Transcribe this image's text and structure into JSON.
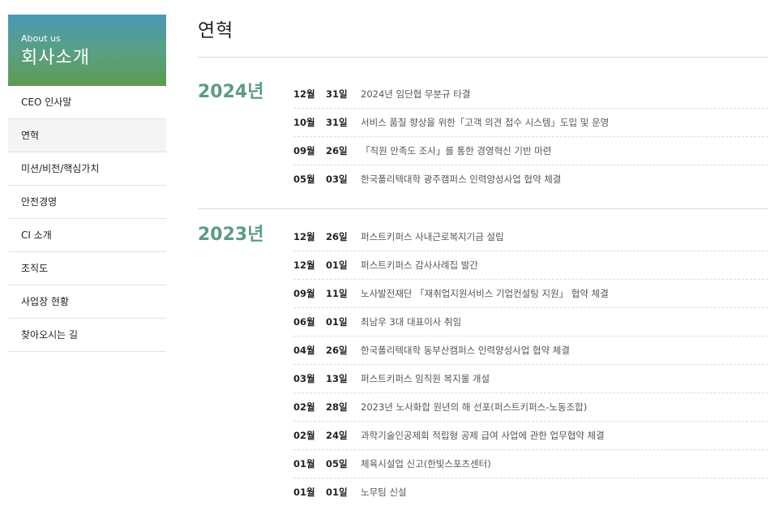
{
  "sidebar": {
    "subtitle": "About us",
    "title": "회사소개",
    "items": [
      {
        "label": "CEO 인사말"
      },
      {
        "label": "연혁"
      },
      {
        "label": "미션/비전/핵심가치"
      },
      {
        "label": "안전경영"
      },
      {
        "label": "CI 소개"
      },
      {
        "label": "조직도"
      },
      {
        "label": "사업장 현황"
      },
      {
        "label": "찾아오시는 길"
      }
    ],
    "active_item": "연혁"
  },
  "main": {
    "title": "연혁",
    "years": [
      {
        "year": "2024년",
        "events": [
          {
            "month": "12월",
            "day": "31일",
            "text": "2024년 임단협 무분규 타결"
          },
          {
            "month": "10월",
            "day": "31일",
            "text": "서비스 품질 향상을 위한「고객 의견 접수 시스템」도입 및 운영"
          },
          {
            "month": "09월",
            "day": "26일",
            "text": "「직원 만족도 조사」를 통한 경영혁신 기반 마련"
          },
          {
            "month": "05월",
            "day": "03일",
            "text": "한국폴리텍대학 광주캠퍼스 인력양성사업 협약 체결"
          }
        ]
      },
      {
        "year": "2023년",
        "events": [
          {
            "month": "12월",
            "day": "26일",
            "text": "퍼스트키퍼스 사내근로복지기금 설립"
          },
          {
            "month": "12월",
            "day": "01일",
            "text": "퍼스트키퍼스 감사사례집 발간"
          },
          {
            "month": "09월",
            "day": "11일",
            "text": "노사발전재단 「재취업지원서비스 기업컨설팅 지원」 협약 체결"
          },
          {
            "month": "06월",
            "day": "01일",
            "text": "최남우 3대 대표이사 취임"
          },
          {
            "month": "04월",
            "day": "26일",
            "text": "한국폴리텍대학 동부산캠퍼스 인력양성사업 협약 체결"
          },
          {
            "month": "03월",
            "day": "13일",
            "text": "퍼스트키퍼스 임직원 복지몰 개설"
          },
          {
            "month": "02월",
            "day": "28일",
            "text": "2023년 노사화합 원년의 해 선포(퍼스트키퍼스-노동조합)"
          },
          {
            "month": "02월",
            "day": "24일",
            "text": "과학기술인공제회 적립형 공제 급여 사업에 관한 업무협약 체결"
          },
          {
            "month": "01월",
            "day": "05일",
            "text": "체육시설업 신고(한빛스포츠센터)"
          },
          {
            "month": "01월",
            "day": "01일",
            "text": "노무팀 신설"
          }
        ]
      }
    ]
  },
  "colors": {
    "header_gradient_top": "#4a98b6",
    "header_gradient_bottom": "#5e9a52",
    "year_color": "#5e9a86"
  }
}
